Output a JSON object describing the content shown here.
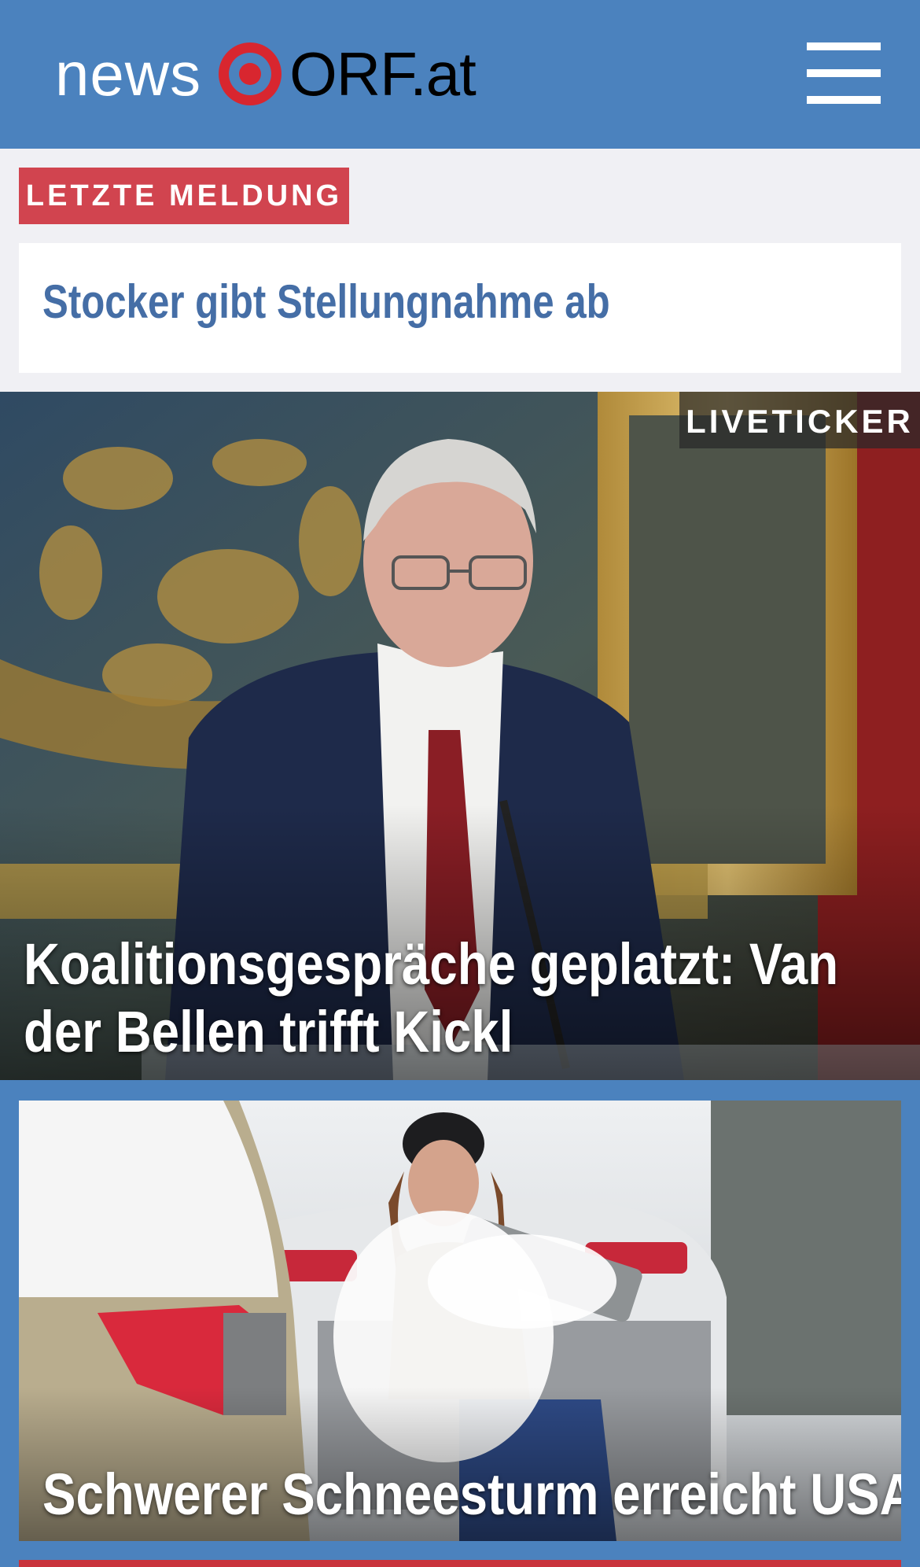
{
  "header": {
    "logo_news": "news",
    "logo_orf": "ORF.at",
    "menu_icon": "hamburger-menu-icon",
    "background_color": "#4b82be"
  },
  "latest": {
    "badge": "LETZTE MELDUNG",
    "headline": "Stocker gibt Stellungnahme ab",
    "badge_color": "#d1444f",
    "headline_color": "#456ea6"
  },
  "hero_story": {
    "badge": "LIVETICKER",
    "headline": "Koalitionsgespräche geplatzt: Van der Bellen trifft Kickl"
  },
  "second_story": {
    "headline": "Schwerer Schneesturm erreicht USA"
  }
}
